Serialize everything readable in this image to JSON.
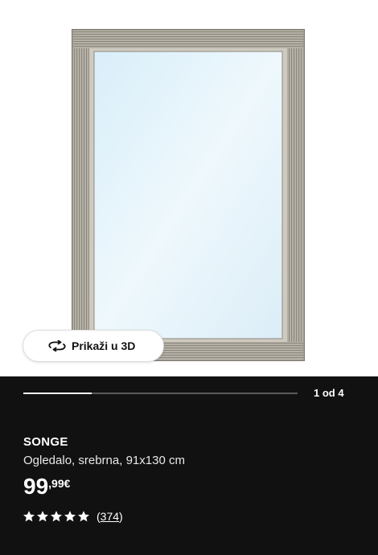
{
  "product_image": {
    "alt": ""
  },
  "view_3d": {
    "label": "Prikaži u 3D",
    "icon": "rotate-3d-icon"
  },
  "carousel": {
    "counter": "1 od 4",
    "progress": 0.25
  },
  "product": {
    "name": "SONGE",
    "description": "Ogledalo, srebrna, 91x130 cm",
    "price_int": "99",
    "price_dec": ",99€",
    "rating_value": 5,
    "rating_max": 5,
    "reviews_open": "(",
    "reviews_count": "374",
    "reviews_close": ")"
  },
  "colors": {
    "panel_bg": "#111111",
    "frame_silver": "#a8a398",
    "glass": "#e3f2fb"
  }
}
